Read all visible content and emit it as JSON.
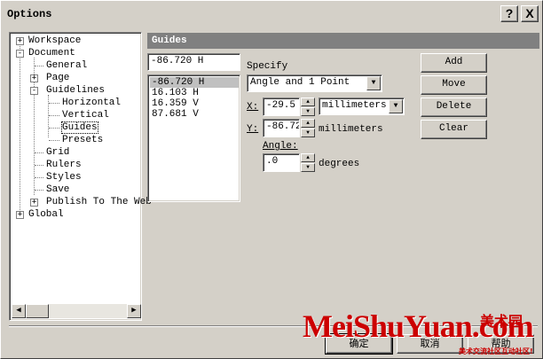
{
  "window": {
    "title": "Options",
    "help_label": "?",
    "close_label": "X"
  },
  "tree": {
    "items": [
      {
        "label": "Workspace",
        "expander": "+"
      },
      {
        "label": "Document",
        "expander": "-"
      },
      {
        "label": "General"
      },
      {
        "label": "Page",
        "expander": "+"
      },
      {
        "label": "Guidelines",
        "expander": "-"
      },
      {
        "label": "Horizontal"
      },
      {
        "label": "Vertical"
      },
      {
        "label": "Guides",
        "selected": true
      },
      {
        "label": "Presets"
      },
      {
        "label": "Grid"
      },
      {
        "label": "Rulers"
      },
      {
        "label": "Styles"
      },
      {
        "label": "Save"
      },
      {
        "label": "Publish To The Web",
        "expander": "+"
      },
      {
        "label": "Global",
        "expander": "+"
      }
    ]
  },
  "section": {
    "header": "Guides"
  },
  "guides": {
    "current_value": "-86.720 H",
    "list": [
      "-86.720 H",
      "16.103 H",
      "16.359 V",
      "87.681 V"
    ],
    "selected_index": 0
  },
  "specify": {
    "label": "Specify",
    "value": "Angle and 1 Point"
  },
  "x": {
    "label": "X:",
    "value": "-29.5",
    "unit": "millimeters"
  },
  "y": {
    "label": "Y:",
    "value": "-86.72",
    "unit": "millimeters"
  },
  "angle": {
    "label": "Angle:",
    "value": ".0",
    "unit": "degrees"
  },
  "buttons": {
    "add": "Add",
    "move": "Move",
    "delete": "Delete",
    "clear": "Clear"
  },
  "footer": {
    "ok": "确定",
    "cancel": "取消",
    "help": "帮助"
  },
  "watermark": {
    "text": "MeiShuYuan.com",
    "cn": "美术园",
    "sub": "美术交流社区互动社区!"
  },
  "icons": {
    "up": "triangle-up-icon",
    "down": "triangle-down-icon",
    "left": "triangle-left-icon",
    "right": "triangle-right-icon"
  }
}
